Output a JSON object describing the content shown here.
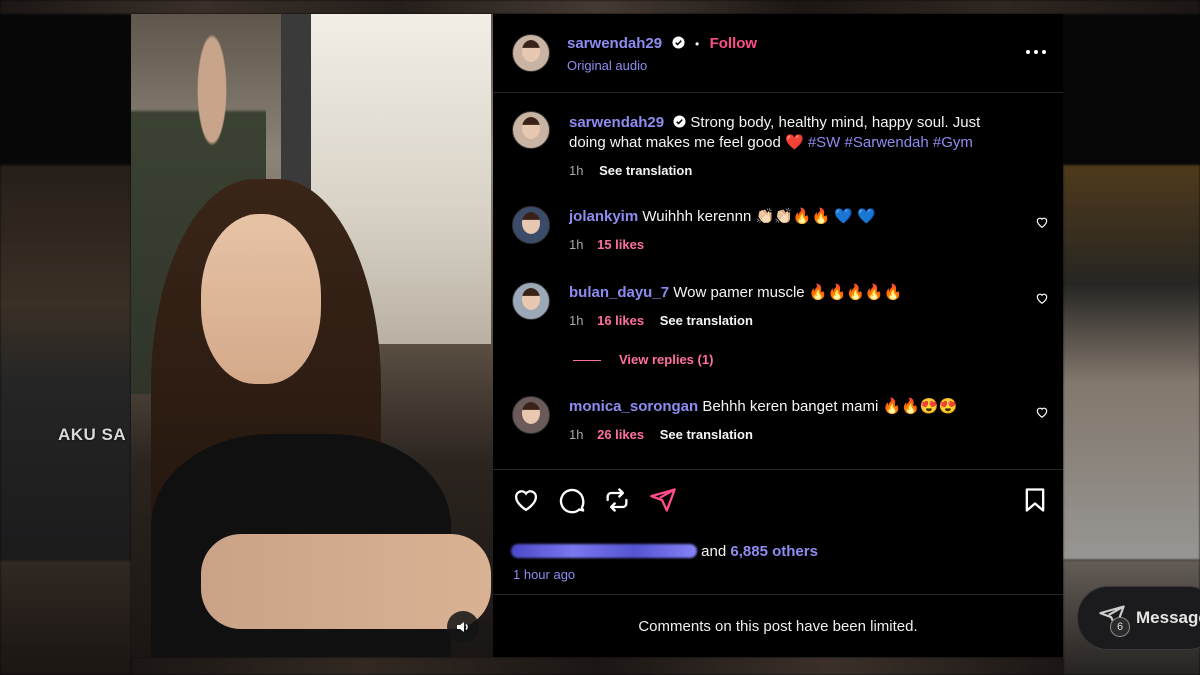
{
  "background": {
    "left_tile_text": "AKU SA"
  },
  "post": {
    "author": "sarwendah29",
    "follow_label": "Follow",
    "separator": "•",
    "audio": "Original audio",
    "caption": {
      "username": "sarwendah29",
      "text": "Strong body, healthy mind, happy soul. Just doing what makes me feel good",
      "emoji": "❤️",
      "hashtags": [
        "#SW",
        "#Sarwendah",
        "#Gym"
      ],
      "time": "1h",
      "see_translation": "See translation"
    },
    "comments": [
      {
        "username": "jolankyim",
        "text": "Wuihhh kerennn 👏🏻👏🏻🔥🔥 💙 💙",
        "time": "1h",
        "likes": "15 likes",
        "see_translation": ""
      },
      {
        "username": "bulan_dayu_7",
        "text": "Wow pamer muscle 🔥🔥🔥🔥🔥",
        "time": "1h",
        "likes": "16 likes",
        "see_translation": "See translation",
        "view_replies": "View replies (1)"
      },
      {
        "username": "monica_sorongan",
        "text": "Behhh keren banget mami 🔥🔥😍😍",
        "time": "1h",
        "likes": "26 likes",
        "see_translation": "See translation"
      }
    ],
    "liked_by_suffix": "and",
    "liked_by_others": "6,885 others",
    "time_ago": "1 hour ago",
    "comments_limited": "Comments on this post have been limited."
  },
  "messages": {
    "label": "Messages",
    "badge": "6"
  },
  "colors": {
    "accent_blue": "#8e8cf0",
    "accent_pink": "#ff4d8a",
    "panel_bg": "#000000"
  }
}
